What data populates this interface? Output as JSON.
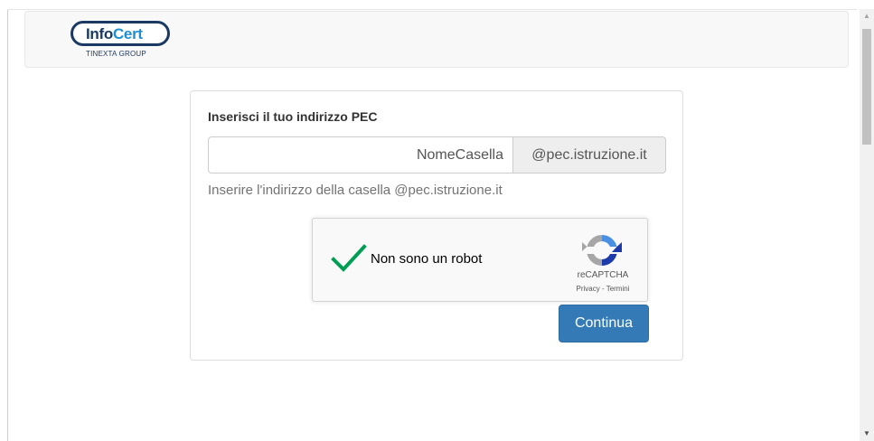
{
  "header": {
    "logo": {
      "part1": "Info",
      "part2": "Cert",
      "subtitle": "TINEXTA GROUP"
    }
  },
  "form": {
    "title": "Inserisci il tuo indirizzo PEC",
    "pec_input": {
      "value": "",
      "placeholder": "NomeCasella"
    },
    "domain_suffix": "@pec.istruzione.it",
    "help": "Inserire l'indirizzo della casella @pec.istruzione.it",
    "recaptcha": {
      "label": "Non sono un robot",
      "checked": true,
      "brand": "reCAPTCHA",
      "links": "Privacy - Termini"
    },
    "submit_label": "Continua"
  },
  "colors": {
    "primary_button": "#337ab7",
    "check_green": "#009e55",
    "logo_navy": "#1b3a63",
    "logo_blue": "#1c8fd3"
  },
  "icons": {
    "check": "check-icon",
    "recaptcha": "recaptcha-logo-icon",
    "scroll_up": "triangle-up",
    "scroll_down": "triangle-down"
  }
}
